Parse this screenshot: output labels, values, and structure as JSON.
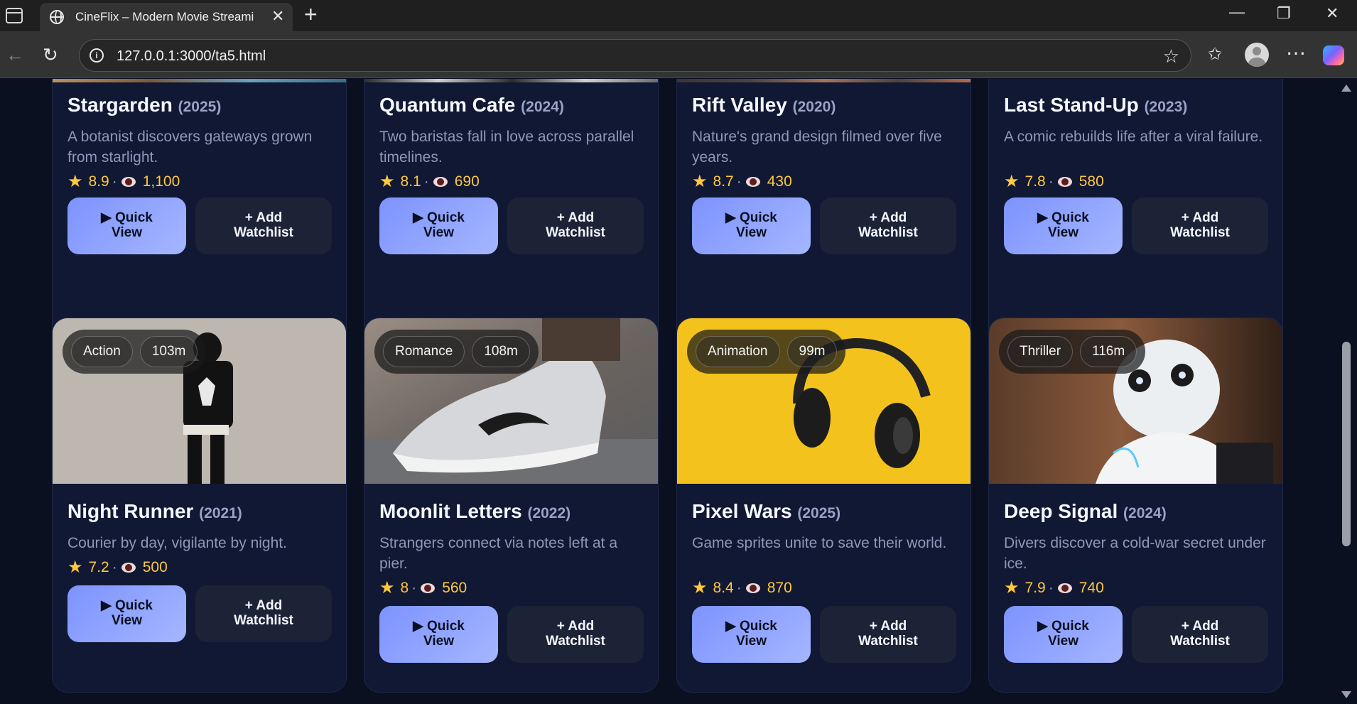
{
  "browser": {
    "tab_title": "CineFlix – Modern Movie Streaming",
    "url": "127.0.0.1:3000/ta5.html"
  },
  "colors": {
    "page_bg": "#0b1020",
    "card_bg": "#111833",
    "accent": "#8ea2ff",
    "rating": "#ffc83d"
  },
  "top_row": [
    {
      "title": "Stargarden",
      "year": "(2025)",
      "desc": "A botanist discovers gateways grown from starlight.",
      "rating": "8.9",
      "views": "1,100"
    },
    {
      "title": "Quantum Cafe",
      "year": "(2024)",
      "desc": "Two baristas fall in love across parallel timelines.",
      "rating": "8.1",
      "views": "690"
    },
    {
      "title": "Rift Valley",
      "year": "(2020)",
      "desc": "Nature's grand design filmed over five years.",
      "rating": "8.7",
      "views": "430"
    },
    {
      "title": "Last Stand-Up",
      "year": "(2023)",
      "desc": "A comic rebuilds life after a viral failure.",
      "rating": "7.8",
      "views": "580"
    }
  ],
  "bottom_row": [
    {
      "genre": "Action",
      "duration": "103m",
      "title": "Night Runner",
      "year": "(2021)",
      "desc": "Courier by day, vigilante by night.",
      "rating": "7.2",
      "views": "500"
    },
    {
      "genre": "Romance",
      "duration": "108m",
      "title": "Moonlit Letters",
      "year": "(2022)",
      "desc": "Strangers connect via notes left at a pier.",
      "rating": "8",
      "views": "560"
    },
    {
      "genre": "Animation",
      "duration": "99m",
      "title": "Pixel Wars",
      "year": "(2025)",
      "desc": "Game sprites unite to save their world.",
      "rating": "8.4",
      "views": "870"
    },
    {
      "genre": "Thriller",
      "duration": "116m",
      "title": "Deep Signal",
      "year": "(2024)",
      "desc": "Divers discover a cold-war secret under ice.",
      "rating": "7.9",
      "views": "740"
    }
  ],
  "buttons": {
    "quick_view_1": "▶ Quick",
    "quick_view_2": "View",
    "watchlist_1": "+ Add",
    "watchlist_2": "Watchlist"
  },
  "icons": {
    "star": "star-icon",
    "views": "eye-icon"
  }
}
